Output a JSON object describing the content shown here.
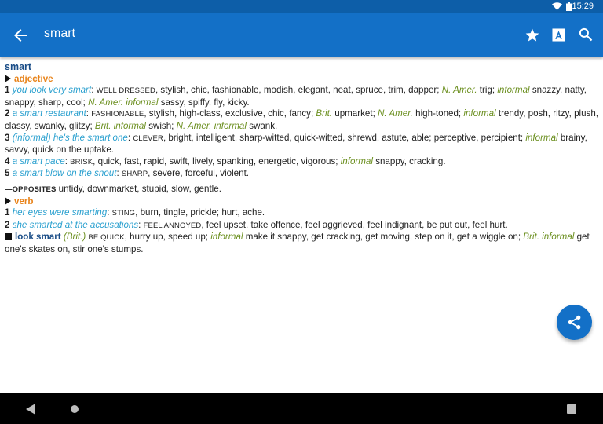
{
  "status_bar": {
    "time": "15:29"
  },
  "app_bar": {
    "title": "smart",
    "icons": [
      "back-arrow-icon",
      "star-icon",
      "font-size-icon",
      "search-icon"
    ]
  },
  "entry": {
    "headword": "smart",
    "adjective": {
      "pos": "adjective",
      "senses": [
        {
          "num": "1",
          "example": "you look very smart",
          "keyword": "WELL DRESSED",
          "text1": ", stylish, chic, fashionable, modish, elegant, neat, spruce, trim, dapper; ",
          "reg1": "N. Amer.",
          "text2": " trig; ",
          "reg2": "informal",
          "text3": " snazzy, natty, snappy, sharp, cool; ",
          "reg3": "N. Amer. informal",
          "text4": " sassy, spiffy, fly, kicky."
        },
        {
          "num": "2",
          "example": "a smart restaurant",
          "keyword": "FASHIONABLE",
          "text1": ", stylish, high-class, exclusive, chic, fancy; ",
          "reg1": "Brit.",
          "text2": " upmarket; ",
          "reg2": "N. Amer.",
          "text3": " high-toned; ",
          "reg3": "informal",
          "text4": " trendy, posh, ritzy, plush, classy, swanky, glitzy; ",
          "reg4": "Brit. informal",
          "text5": " swish; ",
          "reg5": "N. Amer. informal",
          "text6": " swank."
        },
        {
          "num": "3",
          "example": "(informal) he's the smart one",
          "keyword": "CLEVER",
          "text1": ", bright, intelligent, sharp-witted, quick-witted, shrewd, astute, able; perceptive, percipient; ",
          "reg1": "informal",
          "text2": " brainy, savvy, quick on the uptake."
        },
        {
          "num": "4",
          "example": "a smart pace",
          "keyword": "BRISK",
          "text1": ", quick, fast, rapid, swift, lively, spanking, energetic, vigorous; ",
          "reg1": "informal",
          "text2": " snappy, cracking."
        },
        {
          "num": "5",
          "example": "a smart blow on the snout",
          "keyword": "SHARP",
          "text1": ", severe, forceful, violent."
        }
      ],
      "opposites_label": "—OPPOSITES",
      "opposites": " untidy, downmarket, stupid, slow, gentle."
    },
    "verb": {
      "pos": "verb",
      "senses": [
        {
          "num": "1",
          "example": "her eyes were smarting",
          "keyword": "STING",
          "text1": ", burn, tingle, prickle; hurt, ache."
        },
        {
          "num": "2",
          "example": "she smarted at the accusations",
          "keyword": "FEEL ANNOYED",
          "text1": ", feel upset, take offence, feel aggrieved, feel indignant, be put out, feel hurt."
        }
      ],
      "idiom": {
        "phrase": "look smart",
        "region": "(Brit.)",
        "keyword": "BE QUICK",
        "text1": ", hurry up, speed up; ",
        "reg1": "informal",
        "text2": " make it snappy, get cracking, get moving, step on it, get a wiggle on; ",
        "reg2": "Brit. informal",
        "text3": " get one's skates on, stir one's stumps."
      }
    }
  },
  "fab": {
    "icon": "share-icon"
  },
  "nav_bar": {
    "icons": [
      "nav-back-icon",
      "nav-home-icon",
      "nav-recents-icon"
    ]
  }
}
